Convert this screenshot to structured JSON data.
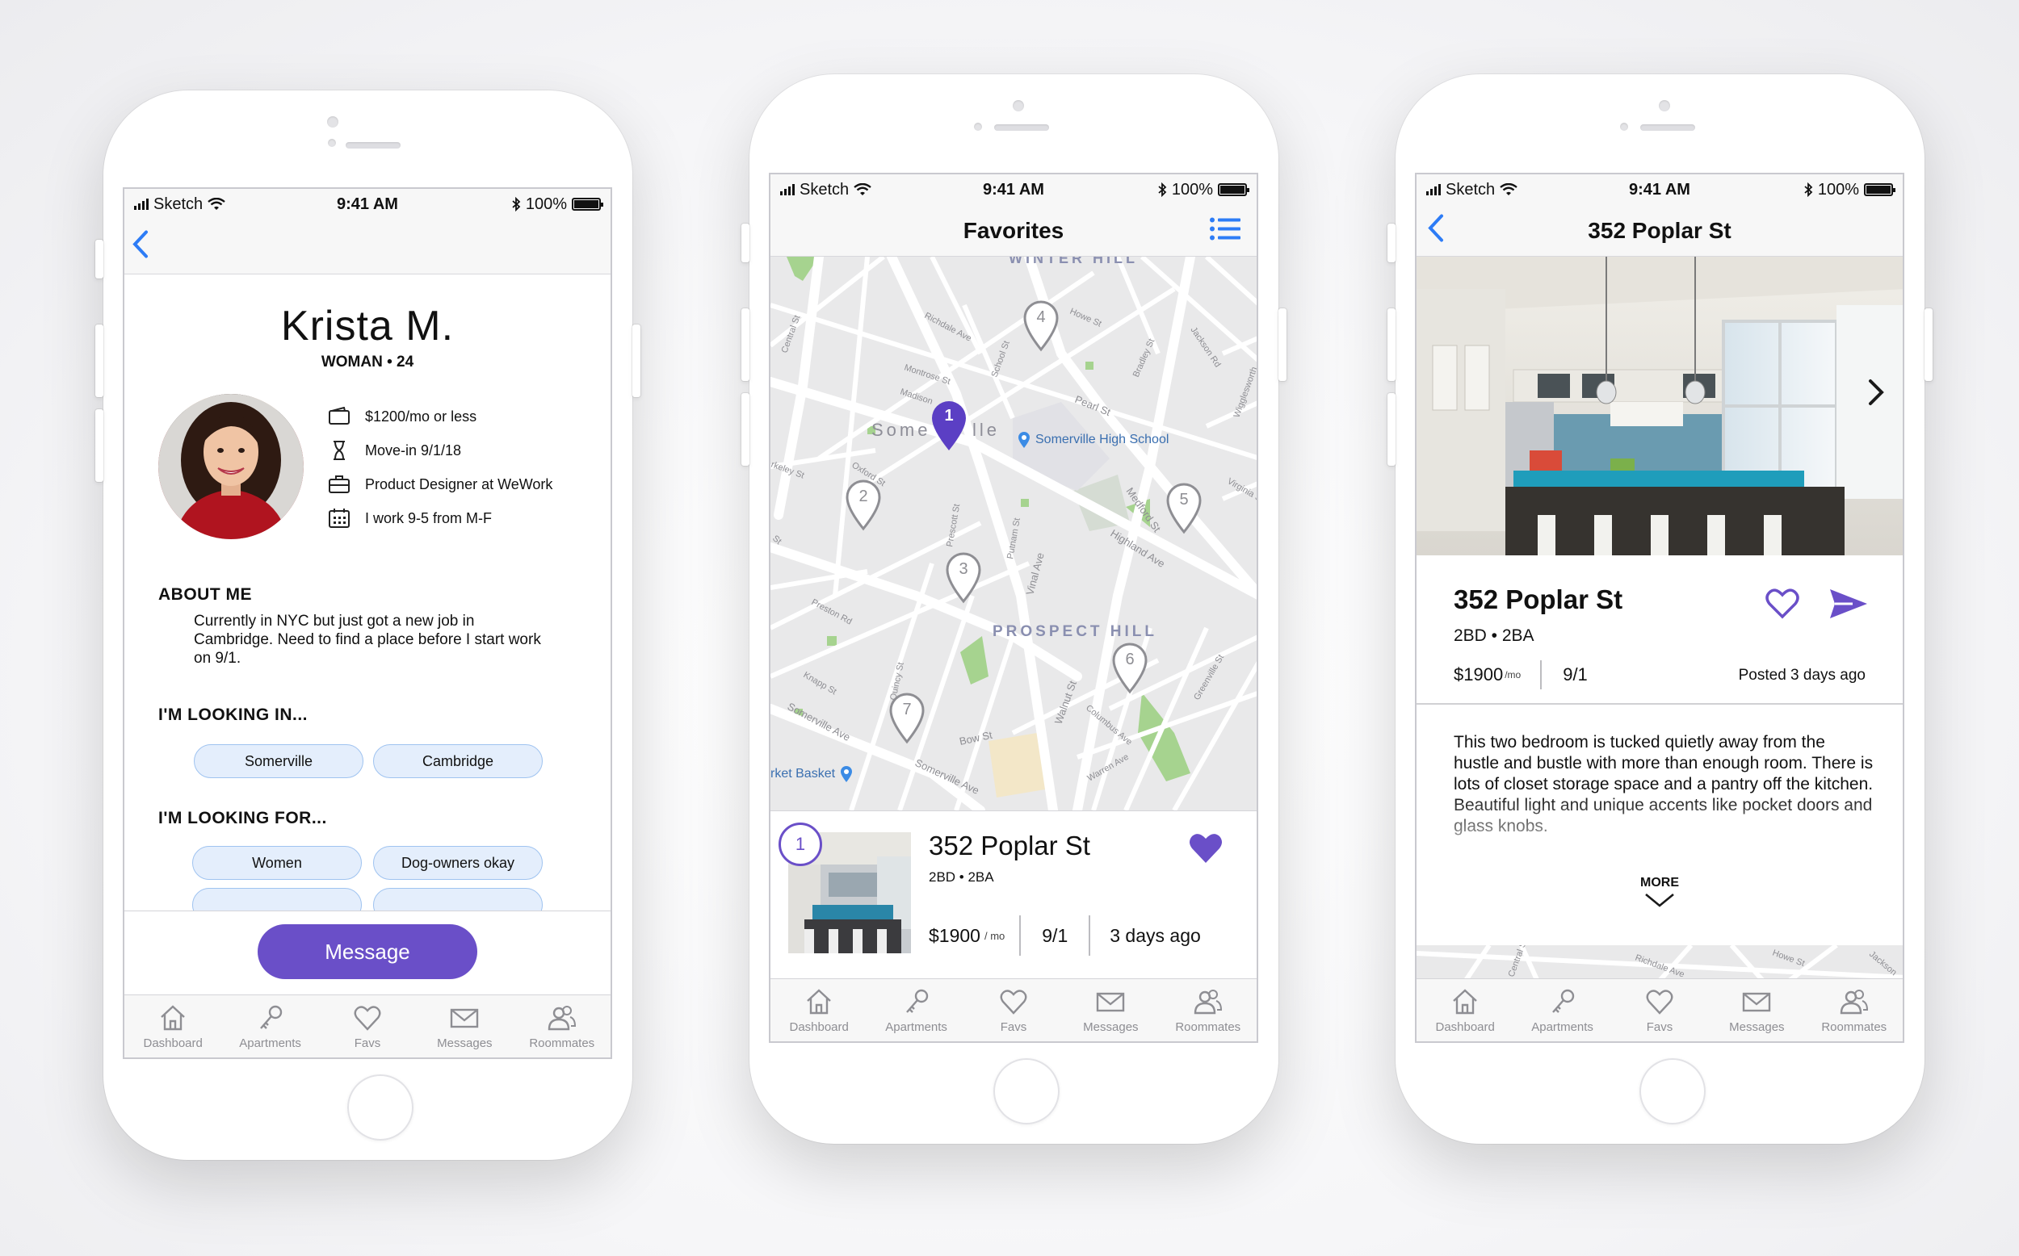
{
  "status": {
    "carrier": "Sketch",
    "time": "9:41 AM",
    "battery": "100%"
  },
  "tabs": [
    "Dashboard",
    "Apartments",
    "Favs",
    "Messages",
    "Roommates"
  ],
  "profile": {
    "name": "Krista M.",
    "subtitle": "WOMAN • 24",
    "details": [
      {
        "icon": "wallet-icon",
        "text": "$1200/mo or less"
      },
      {
        "icon": "hourglass-icon",
        "text": "Move-in 9/1/18"
      },
      {
        "icon": "briefcase-icon",
        "text": "Product Designer at WeWork"
      },
      {
        "icon": "calendar-icon",
        "text": "I work 9-5 from M-F"
      }
    ],
    "about_heading": "ABOUT ME",
    "about_text": "Currently in NYC but just got a new job in Cambridge. Need to find a place before I start work on 9/1.",
    "looking_in_heading": "I'M LOOKING IN...",
    "looking_in": [
      "Somerville",
      "Cambridge"
    ],
    "looking_for_heading": "I'M LOOKING FOR...",
    "looking_for": [
      "Women",
      "Dog-owners okay"
    ],
    "message_button": "Message"
  },
  "favorites": {
    "title": "Favorites",
    "map_labels": {
      "winter_hill": "WINTER HILL",
      "prospect_hill": "PROSPECT HILL",
      "somerville": "Some",
      "somerville_end": "lle",
      "high_school": "Somerville High School",
      "market": "rket Basket",
      "streets": [
        "Central St",
        "Richdale Ave",
        "Montrose St",
        "Madison",
        "School St",
        "Pearl St",
        "Howe St",
        "Bradley St",
        "Jackson Rd",
        "Oxford St",
        "Prescott St",
        "Highland Ave",
        "Medford St",
        "Vinal Ave",
        "Putnam St",
        "Preston Rd",
        "Quincy St",
        "Bow St",
        "Somerville Ave",
        "Walnut St",
        "Columbus Ave",
        "Warren Ave",
        "Greenville St",
        "Virginia St",
        "Knapp St",
        "Wigglesworth"
      ]
    },
    "pins": [
      "1",
      "2",
      "3",
      "4",
      "5",
      "6",
      "7"
    ],
    "card": {
      "index": "1",
      "address": "352 Poplar St",
      "specs": "2BD • 2BA",
      "price": "$1900",
      "price_unit": "/ mo",
      "move_in": "9/1",
      "posted": "3 days ago"
    }
  },
  "listing": {
    "title": "352 Poplar St",
    "address": "352 Poplar St",
    "specs": "2BD • 2BA",
    "price": "$1900",
    "price_unit": "/mo",
    "move_in": "9/1",
    "posted": "Posted 3 days ago",
    "description": "This two bedroom is tucked quietly away from the hustle and bustle with more than enough room. There is lots of closet storage space and a pantry off the kitchen. Beautiful light and unique accents like pocket doors and glass knobs.",
    "more_label": "MORE",
    "map_streets": [
      "Central St",
      "Richdale Ave",
      "Howe St",
      "Jackson"
    ]
  },
  "colors": {
    "accent": "#6a4fc8",
    "blue": "#2d7cf6",
    "chip_bg": "#e4eefc"
  }
}
